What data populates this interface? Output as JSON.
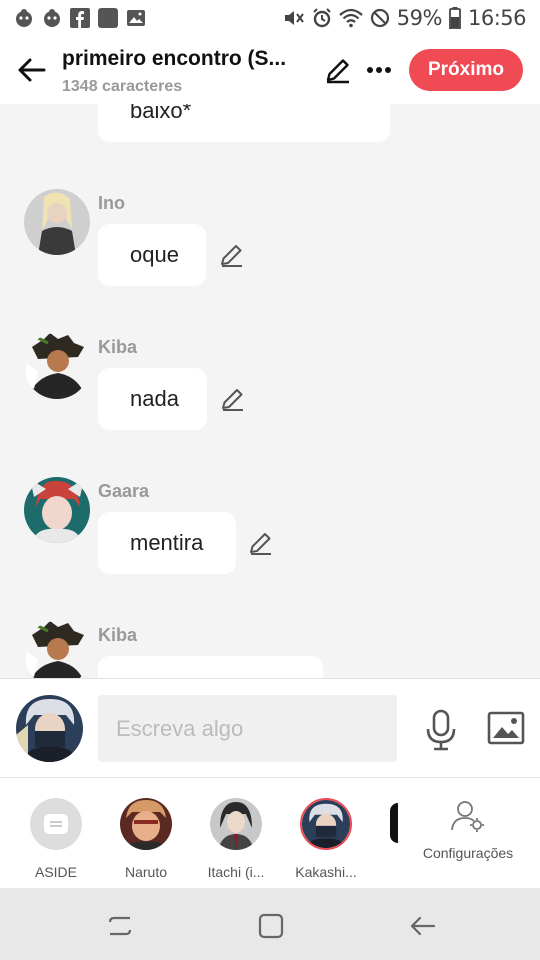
{
  "status": {
    "battery": "59%",
    "time": "16:56",
    "left_icons": [
      "notification-face-icon",
      "notification-face-icon",
      "facebook-icon",
      "app-icon",
      "gallery-icon"
    ],
    "right_icons": [
      "mute-icon",
      "alarm-icon",
      "wifi-icon",
      "do-not-disturb-icon",
      "battery-icon"
    ]
  },
  "header": {
    "title": "primeiro encontro (S...",
    "subtitle": "1348 caracteres",
    "next_label": "Próximo",
    "accent": "#f04a55"
  },
  "messages": [
    {
      "name": "",
      "text": "baixo*"
    },
    {
      "name": "Ino",
      "text": "oque"
    },
    {
      "name": "Kiba",
      "text": "nada"
    },
    {
      "name": "Gaara",
      "text": "mentira"
    },
    {
      "name": "Kiba",
      "text": ""
    }
  ],
  "composer": {
    "placeholder": "Escreva algo"
  },
  "characters": [
    {
      "label": "ASIDE"
    },
    {
      "label": "Naruto"
    },
    {
      "label": "Itachi (i..."
    },
    {
      "label": "Kakashi..."
    }
  ],
  "settings_label": "Configurações"
}
